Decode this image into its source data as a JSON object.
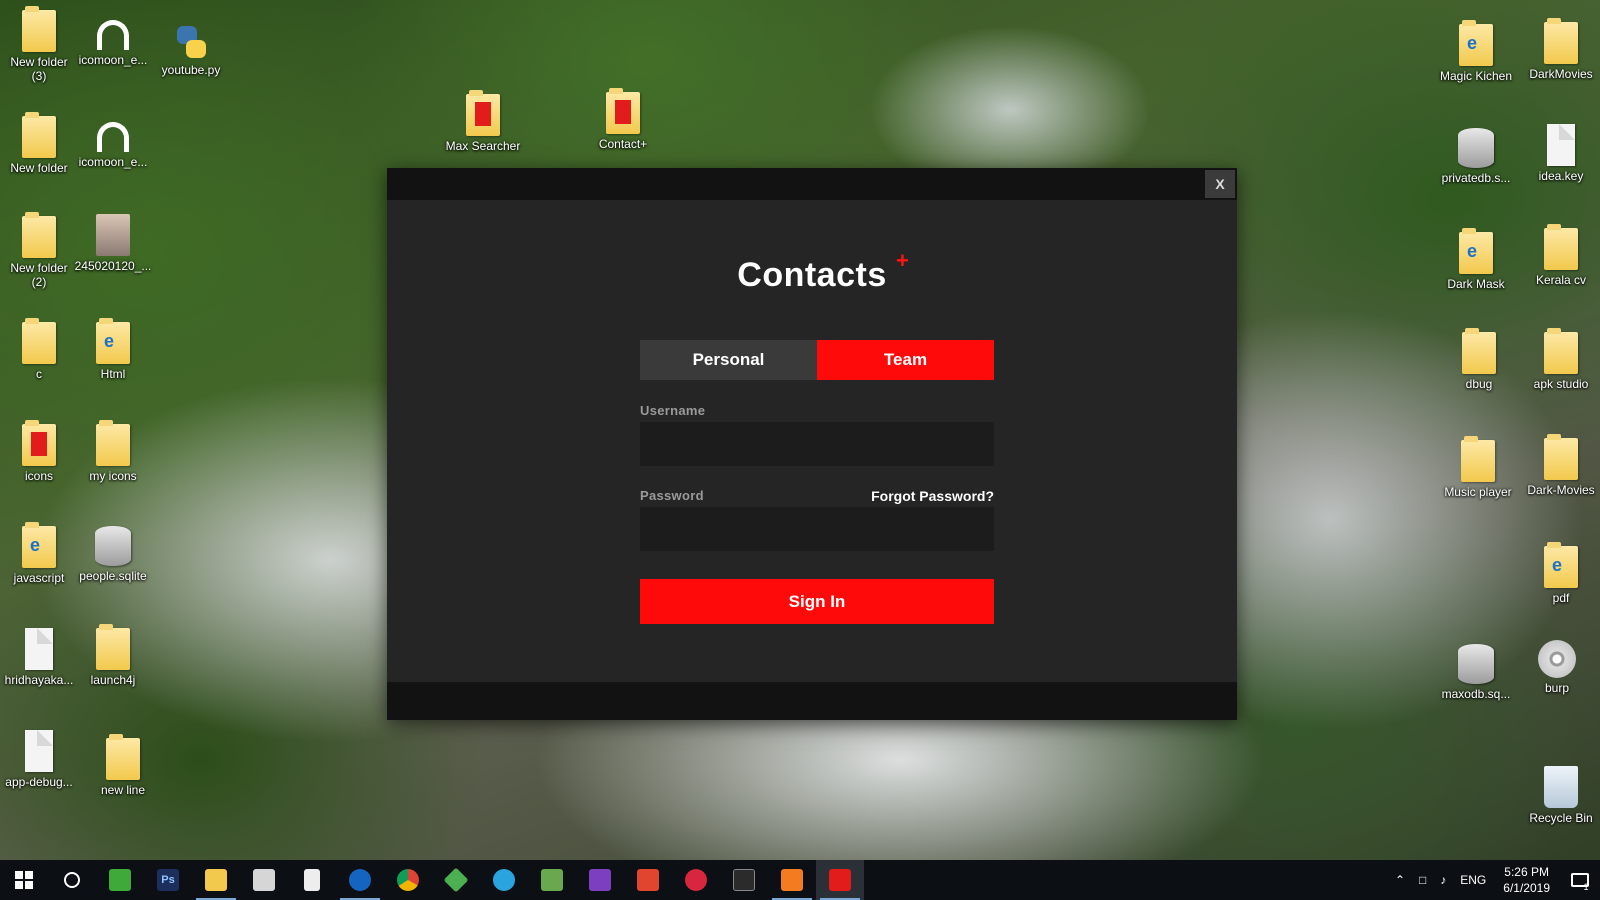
{
  "desktop": {
    "icons": [
      {
        "label": "New folder\n(3)",
        "kind": "folder"
      },
      {
        "label": "icomoon_e...",
        "kind": "headphone"
      },
      {
        "label": "youtube.py",
        "kind": "python"
      },
      {
        "label": "New folder",
        "kind": "folder"
      },
      {
        "label": "icomoon_e...",
        "kind": "headphone"
      },
      {
        "label": "New folder\n(2)",
        "kind": "folder"
      },
      {
        "label": "245020120_...",
        "kind": "photo"
      },
      {
        "label": "c",
        "kind": "folder"
      },
      {
        "label": "Html",
        "kind": "folder-e"
      },
      {
        "label": "icons",
        "kind": "folder-red"
      },
      {
        "label": "my icons",
        "kind": "folder"
      },
      {
        "label": "javascript",
        "kind": "folder-e"
      },
      {
        "label": "people.sqlite",
        "kind": "db"
      },
      {
        "label": "hridhayaka...",
        "kind": "file"
      },
      {
        "label": "launch4j",
        "kind": "folder"
      },
      {
        "label": "app-debug...",
        "kind": "file"
      },
      {
        "label": "new line",
        "kind": "folder"
      },
      {
        "label": "Max Searcher",
        "kind": "folder-red"
      },
      {
        "label": "Contact+",
        "kind": "folder-red"
      },
      {
        "label": "Magic Kichen",
        "kind": "folder-e"
      },
      {
        "label": "DarkMovies",
        "kind": "folder"
      },
      {
        "label": "privatedb.s...",
        "kind": "db"
      },
      {
        "label": "idea.key",
        "kind": "file"
      },
      {
        "label": "Dark Mask",
        "kind": "folder-e"
      },
      {
        "label": "Kerala cv",
        "kind": "folder"
      },
      {
        "label": "dbug",
        "kind": "folder"
      },
      {
        "label": "apk studio",
        "kind": "folder"
      },
      {
        "label": "Music player",
        "kind": "folder"
      },
      {
        "label": "Dark-Movies",
        "kind": "folder"
      },
      {
        "label": "pdf",
        "kind": "folder-e"
      },
      {
        "label": "maxodb.sq...",
        "kind": "db"
      },
      {
        "label": "burp",
        "kind": "disc"
      },
      {
        "label": "Recycle Bin",
        "kind": "recycle"
      }
    ]
  },
  "modal": {
    "close_label": "X",
    "brand_title": "Contacts",
    "brand_mark": "+",
    "tabs": [
      {
        "label": "Personal",
        "active": false
      },
      {
        "label": "Team",
        "active": true
      }
    ],
    "username_label": "Username",
    "username_value": "",
    "password_label": "Password",
    "password_value": "",
    "forgot_label": "Forgot Password?",
    "signin_label": "Sign In",
    "accent_color": "#ff0a0a"
  },
  "taskbar": {
    "apps": [
      {
        "name": "start-button",
        "icon": "windows-logo-icon"
      },
      {
        "name": "cortana-search",
        "icon": "search-ring-icon"
      },
      {
        "name": "camtasia",
        "icon": "camtasia-icon",
        "color": "#3fa93a",
        "open": false
      },
      {
        "name": "photoshop",
        "icon": "photoshop-icon",
        "color": "#1c2f5c",
        "glyph": "Ps",
        "open": false
      },
      {
        "name": "file-explorer",
        "icon": "folder-icon",
        "color": "#f2c94c",
        "open": true
      },
      {
        "name": "mail",
        "icon": "mail-icon",
        "color": "#d6d6d6",
        "open": false
      },
      {
        "name": "notepad",
        "icon": "file-icon",
        "color": "#ededed",
        "open": false
      },
      {
        "name": "firefox",
        "icon": "firefox-icon",
        "color": "#1565c0",
        "open": true
      },
      {
        "name": "chrome",
        "icon": "chrome-icon",
        "color": "#db4437",
        "open": false
      },
      {
        "name": "sketchup",
        "icon": "diamond-icon",
        "color": "#4caf50",
        "open": false
      },
      {
        "name": "telegram",
        "icon": "telegram-icon",
        "color": "#2aa4de",
        "open": false
      },
      {
        "name": "spreadsheet",
        "icon": "chart-icon",
        "color": "#6aa84f",
        "open": false
      },
      {
        "name": "visual-studio",
        "icon": "visual-studio-icon",
        "color": "#7c3fbf",
        "open": false
      },
      {
        "name": "camtasia-red",
        "icon": "c-icon",
        "color": "#e2452f",
        "open": false
      },
      {
        "name": "search-tool",
        "icon": "magnifier-icon",
        "color": "#d7263d",
        "open": false
      },
      {
        "name": "terminal",
        "icon": "terminal-icon",
        "color": "#2b2b2b",
        "open": false
      },
      {
        "name": "xampp",
        "icon": "xampp-icon",
        "color": "#f47b20",
        "open": true
      },
      {
        "name": "contacts-app",
        "icon": "contacts-app-icon",
        "color": "#e21b1b",
        "open": true,
        "focused": true
      }
    ],
    "tray": {
      "lang": "ENG",
      "time": "5:26 PM",
      "date": "6/1/2019",
      "notification_count": "1"
    }
  }
}
